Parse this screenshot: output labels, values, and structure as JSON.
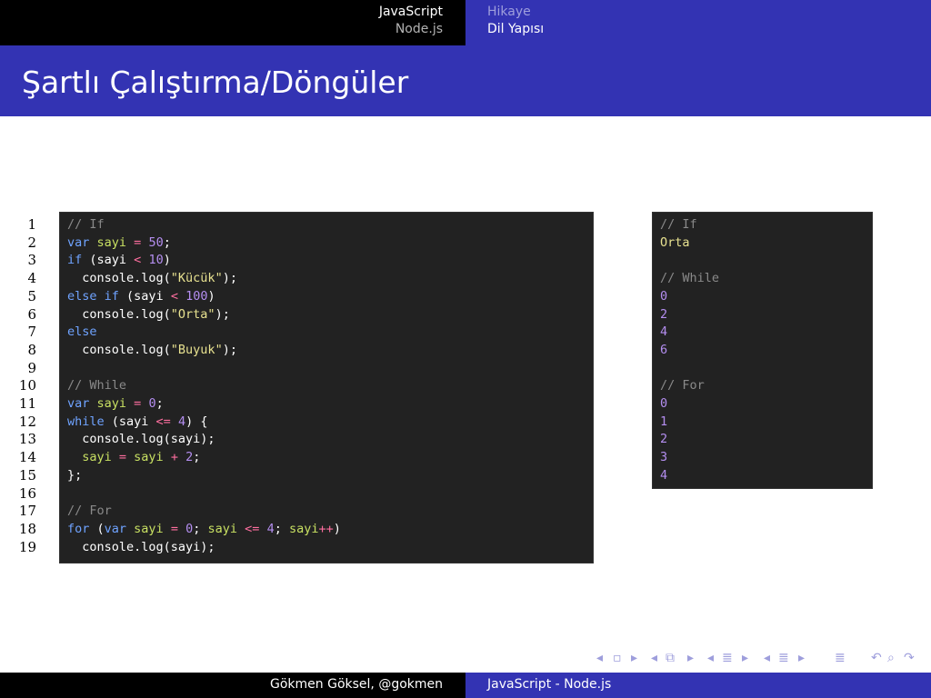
{
  "header": {
    "left_items": [
      "JavaScript",
      "Node.js"
    ],
    "right_items": [
      "Hikaye",
      "Dil Yapısı"
    ]
  },
  "title": "Şartlı Çalıştırma/Döngüler",
  "code": {
    "line_numbers": [
      "1",
      "2",
      "3",
      "4",
      "5",
      "6",
      "7",
      "8",
      "9",
      "10",
      "11",
      "12",
      "13",
      "14",
      "15",
      "16",
      "17",
      "18",
      "19"
    ],
    "lines": [
      [
        {
          "t": "// If",
          "c": "comment"
        }
      ],
      [
        {
          "t": "var",
          "c": "kw"
        },
        {
          "t": " sayi ",
          "c": "ident"
        },
        {
          "t": "=",
          "c": "op"
        },
        {
          "t": " ",
          "c": "plain"
        },
        {
          "t": "50",
          "c": "num"
        },
        {
          "t": ";",
          "c": "plain"
        }
      ],
      [
        {
          "t": "if",
          "c": "kw"
        },
        {
          "t": " (sayi ",
          "c": "plain"
        },
        {
          "t": "<",
          "c": "op"
        },
        {
          "t": " ",
          "c": "plain"
        },
        {
          "t": "10",
          "c": "num"
        },
        {
          "t": ")",
          "c": "plain"
        }
      ],
      [
        {
          "t": "  console.log(",
          "c": "plain"
        },
        {
          "t": "\"Kücük\"",
          "c": "str"
        },
        {
          "t": ");",
          "c": "plain"
        }
      ],
      [
        {
          "t": "else if",
          "c": "kw"
        },
        {
          "t": " (sayi ",
          "c": "plain"
        },
        {
          "t": "<",
          "c": "op"
        },
        {
          "t": " ",
          "c": "plain"
        },
        {
          "t": "100",
          "c": "num"
        },
        {
          "t": ")",
          "c": "plain"
        }
      ],
      [
        {
          "t": "  console.log(",
          "c": "plain"
        },
        {
          "t": "\"Orta\"",
          "c": "str"
        },
        {
          "t": ");",
          "c": "plain"
        }
      ],
      [
        {
          "t": "else",
          "c": "kw"
        }
      ],
      [
        {
          "t": "  console.log(",
          "c": "plain"
        },
        {
          "t": "\"Buyuk\"",
          "c": "str"
        },
        {
          "t": ");",
          "c": "plain"
        }
      ],
      [],
      [
        {
          "t": "// While",
          "c": "comment"
        }
      ],
      [
        {
          "t": "var",
          "c": "kw"
        },
        {
          "t": " sayi ",
          "c": "ident"
        },
        {
          "t": "=",
          "c": "op"
        },
        {
          "t": " ",
          "c": "plain"
        },
        {
          "t": "0",
          "c": "num"
        },
        {
          "t": ";",
          "c": "plain"
        }
      ],
      [
        {
          "t": "while",
          "c": "kw"
        },
        {
          "t": " (sayi ",
          "c": "plain"
        },
        {
          "t": "<=",
          "c": "op"
        },
        {
          "t": " ",
          "c": "plain"
        },
        {
          "t": "4",
          "c": "num"
        },
        {
          "t": ") {",
          "c": "plain"
        }
      ],
      [
        {
          "t": "  console.log(sayi);",
          "c": "plain"
        }
      ],
      [
        {
          "t": "  sayi ",
          "c": "ident"
        },
        {
          "t": "=",
          "c": "op"
        },
        {
          "t": " sayi ",
          "c": "ident"
        },
        {
          "t": "+",
          "c": "op"
        },
        {
          "t": " ",
          "c": "plain"
        },
        {
          "t": "2",
          "c": "num"
        },
        {
          "t": ";",
          "c": "plain"
        }
      ],
      [
        {
          "t": "};",
          "c": "plain"
        }
      ],
      [],
      [
        {
          "t": "// For",
          "c": "comment"
        }
      ],
      [
        {
          "t": "for",
          "c": "kw"
        },
        {
          "t": " (",
          "c": "plain"
        },
        {
          "t": "var",
          "c": "kw"
        },
        {
          "t": " sayi ",
          "c": "ident"
        },
        {
          "t": "=",
          "c": "op"
        },
        {
          "t": " ",
          "c": "plain"
        },
        {
          "t": "0",
          "c": "num"
        },
        {
          "t": "; ",
          "c": "plain"
        },
        {
          "t": "sayi ",
          "c": "ident"
        },
        {
          "t": "<=",
          "c": "op"
        },
        {
          "t": " ",
          "c": "plain"
        },
        {
          "t": "4",
          "c": "num"
        },
        {
          "t": "; ",
          "c": "plain"
        },
        {
          "t": "sayi",
          "c": "ident"
        },
        {
          "t": "++",
          "c": "op"
        },
        {
          "t": ")",
          "c": "plain"
        }
      ],
      [
        {
          "t": "  console.log(sayi);",
          "c": "plain"
        }
      ]
    ]
  },
  "output": {
    "lines": [
      {
        "t": "// If",
        "c": "comment"
      },
      {
        "t": "Orta",
        "c": "yellow"
      },
      {
        "t": "",
        "c": "comment"
      },
      {
        "t": "// While",
        "c": "comment"
      },
      {
        "t": "0",
        "c": "purple"
      },
      {
        "t": "2",
        "c": "purple"
      },
      {
        "t": "4",
        "c": "purple"
      },
      {
        "t": "6",
        "c": "purple"
      },
      {
        "t": "",
        "c": "comment"
      },
      {
        "t": "// For",
        "c": "comment"
      },
      {
        "t": "0",
        "c": "purple"
      },
      {
        "t": "1",
        "c": "purple"
      },
      {
        "t": "2",
        "c": "purple"
      },
      {
        "t": "3",
        "c": "purple"
      },
      {
        "t": "4",
        "c": "purple"
      }
    ]
  },
  "nav": {
    "icons": [
      "nav-prev-frame-icon",
      "nav-frame-icon",
      "nav-next-frame-icon",
      "nav-prev-subsection-icon",
      "nav-subsection-icon",
      "nav-next-subsection-icon",
      "nav-prev-section-icon",
      "nav-section-icon",
      "nav-next-section-icon",
      "nav-prev-part-icon",
      "nav-part-icon",
      "nav-next-part-icon",
      "nav-doc-icon",
      "nav-back-icon",
      "nav-search-icon",
      "nav-forward-icon"
    ]
  },
  "footer": {
    "author": "Gökmen Göksel, @gokmen",
    "talk": "JavaScript - Node.js"
  },
  "colors": {
    "accent": "#3333b3",
    "header_dark": "#000000",
    "code_bg": "#222222"
  }
}
